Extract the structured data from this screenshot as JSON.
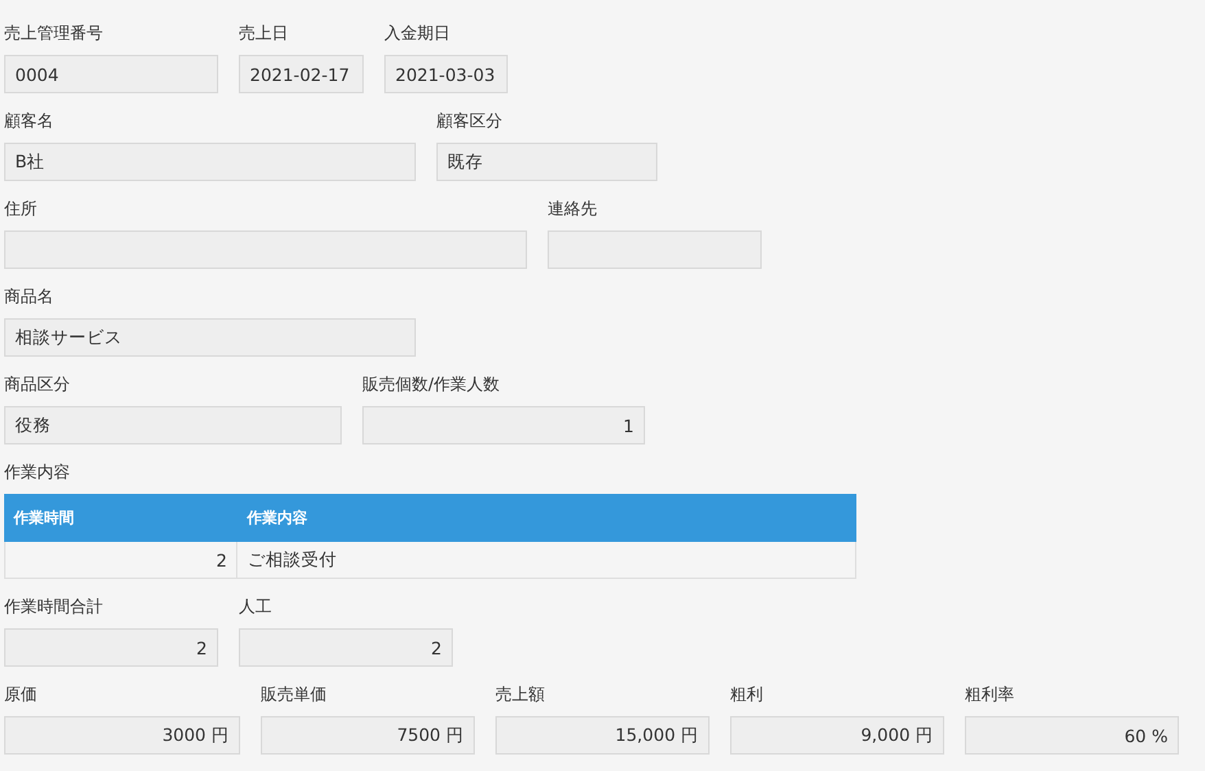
{
  "sections": [
    {
      "kind": "fields",
      "fields": [
        {
          "label": "売上管理番号",
          "value": "0004",
          "kind": "text"
        },
        {
          "label": "売上日",
          "value": "2021-02-17",
          "kind": "text"
        },
        {
          "label": "入金期日",
          "value": "2021-03-03",
          "kind": "text"
        }
      ]
    },
    {
      "kind": "fields",
      "fields": [
        {
          "label": "顧客名",
          "value": "B社",
          "kind": "text"
        },
        {
          "label": "顧客区分",
          "value": "既存",
          "kind": "text"
        }
      ]
    },
    {
      "kind": "fields",
      "fields": [
        {
          "label": "住所",
          "kind": "text"
        },
        {
          "label": "連絡先",
          "kind": "text"
        }
      ]
    },
    {
      "kind": "fields",
      "fields": [
        {
          "label": "商品名",
          "value": "相談サービス",
          "kind": "text"
        }
      ]
    },
    {
      "kind": "fields",
      "fields": [
        {
          "label": "商品区分",
          "value": "役務",
          "kind": "text"
        },
        {
          "label": "販売個数/作業人数",
          "value": "1",
          "kind": "number"
        }
      ]
    },
    {
      "kind": "table",
      "label": "作業内容",
      "columns": [
        "作業時間",
        "作業内容"
      ],
      "rows": [
        [
          "2",
          "ご相談受付"
        ]
      ]
    },
    {
      "kind": "fields",
      "fields": [
        {
          "label": "作業時間合計",
          "value": "2",
          "kind": "number"
        },
        {
          "label": "人工",
          "value": "2",
          "kind": "number"
        }
      ]
    },
    {
      "kind": "fields",
      "fields": [
        {
          "label": "原価",
          "value": "3000 円",
          "kind": "number"
        },
        {
          "label": "販売単価",
          "value": "7500 円",
          "kind": "number"
        },
        {
          "label": "売上額",
          "value": "15,000 円",
          "kind": "number"
        },
        {
          "label": "粗利",
          "value": "9,000 円",
          "kind": "number"
        },
        {
          "label": "粗利率",
          "value": "60 %",
          "kind": "number"
        }
      ]
    }
  ]
}
